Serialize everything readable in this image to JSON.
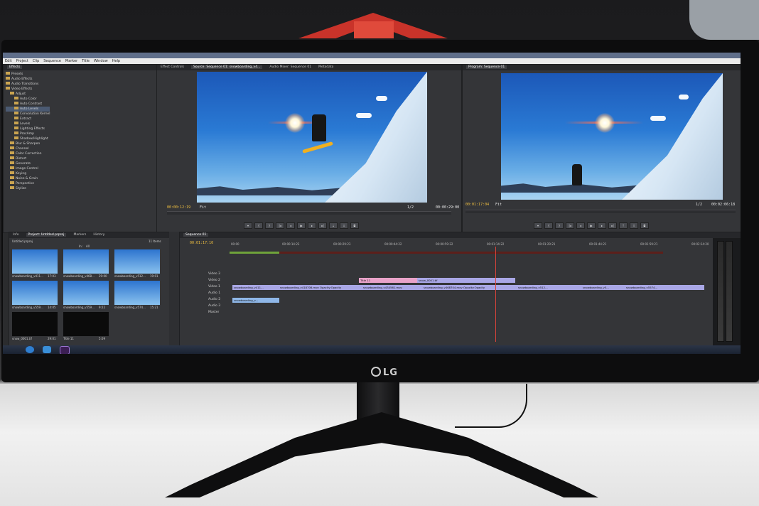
{
  "menu": [
    "Edit",
    "Project",
    "Clip",
    "Sequence",
    "Marker",
    "Title",
    "Window",
    "Help"
  ],
  "effects": {
    "tab": "Effects",
    "items": [
      {
        "label": "Presets",
        "level": 0,
        "selected": false
      },
      {
        "label": "Audio Effects",
        "level": 0,
        "selected": false
      },
      {
        "label": "Audio Transitions",
        "level": 0,
        "selected": false
      },
      {
        "label": "Video Effects",
        "level": 0,
        "selected": false
      },
      {
        "label": "Adjust",
        "level": 1,
        "selected": false
      },
      {
        "label": "Auto Color",
        "level": 2,
        "selected": false
      },
      {
        "label": "Auto Contrast",
        "level": 2,
        "selected": false
      },
      {
        "label": "Auto Levels",
        "level": 2,
        "selected": true
      },
      {
        "label": "Convolution Kernel",
        "level": 2,
        "selected": false
      },
      {
        "label": "Extract",
        "level": 2,
        "selected": false
      },
      {
        "label": "Levels",
        "level": 2,
        "selected": false
      },
      {
        "label": "Lighting Effects",
        "level": 2,
        "selected": false
      },
      {
        "label": "ProcAmp",
        "level": 2,
        "selected": false
      },
      {
        "label": "Shadow/Highlight",
        "level": 2,
        "selected": false
      },
      {
        "label": "Blur & Sharpen",
        "level": 1,
        "selected": false
      },
      {
        "label": "Channel",
        "level": 1,
        "selected": false
      },
      {
        "label": "Color Correction",
        "level": 1,
        "selected": false
      },
      {
        "label": "Distort",
        "level": 1,
        "selected": false
      },
      {
        "label": "Generate",
        "level": 1,
        "selected": false
      },
      {
        "label": "Image Control",
        "level": 1,
        "selected": false
      },
      {
        "label": "Keying",
        "level": 1,
        "selected": false
      },
      {
        "label": "Noise & Grain",
        "level": 1,
        "selected": false
      },
      {
        "label": "Perspective",
        "level": 1,
        "selected": false
      },
      {
        "label": "Stylize",
        "level": 1,
        "selected": false
      }
    ]
  },
  "source": {
    "tabs": [
      "Effect Controls",
      "Source: Sequence 01: snowboarding_v4...",
      "Audio Mixer: Sequence 01",
      "Metadata"
    ],
    "timecode_in": "00:00:12:19",
    "fit": "Fit",
    "zoom": "1/2",
    "timecode_out": "00:00:29:00"
  },
  "program": {
    "tab": "Program: Sequence 01",
    "timecode_in": "00:01:17:04",
    "fit": "Fit",
    "zoom": "1/2",
    "timecode_out": "00:02:06:18"
  },
  "project": {
    "tabs": [
      "Info",
      "Project: Untitled.prproj",
      "Markers",
      "History"
    ],
    "file": "Untitled.prproj",
    "items_count": "11 Items",
    "in_label": "In:",
    "in_value": "All",
    "items": [
      {
        "name": "snowboarding_v411...",
        "dur": "17:03",
        "dark": false
      },
      {
        "name": "snowboarding_v468...",
        "dur": "29:00",
        "dark": false
      },
      {
        "name": "snowboarding_v512...",
        "dur": "19:01",
        "dark": false
      },
      {
        "name": "snowboarding_v559...",
        "dur": "14:05",
        "dark": false
      },
      {
        "name": "snowboarding_v559...",
        "dur": "9:22",
        "dark": false
      },
      {
        "name": "snowboarding_v574...",
        "dur": "15:21",
        "dark": false
      },
      {
        "name": "snow_0001.tif",
        "dur": "29:01",
        "dark": true
      },
      {
        "name": "Title 11",
        "dur": "5:09",
        "dark": true
      }
    ]
  },
  "timeline": {
    "tab": "Sequence 01",
    "timecode": "00:01:17:10",
    "ticks": [
      "00:00",
      "00:00:14:23",
      "00:00:29:23",
      "00:00:44:22",
      "00:00:59:22",
      "00:01:14:22",
      "00:01:29:21",
      "00:01:44:21",
      "00:01:59:21",
      "00:02:14:20"
    ],
    "tracks": [
      "Video 3",
      "Video 2",
      "Video 1",
      "Audio 1",
      "Audio 2",
      "Audio 3",
      "Master"
    ],
    "clips": {
      "title": "Title 11",
      "still": "snow_0001.tif",
      "v1": [
        "snowboarding_v411...",
        "snowboarding_v418706.mov  Opacity:Opacity",
        "snowboarding_v434561.mov",
        "snowboarding_v468704.mov  Opacity:Opacity",
        "snowboarding_v512...",
        "snowboarding_v5...",
        "snowboarding_v5574..."
      ],
      "a1": "snowboarding_v..."
    }
  },
  "monitor_brand": "LG"
}
